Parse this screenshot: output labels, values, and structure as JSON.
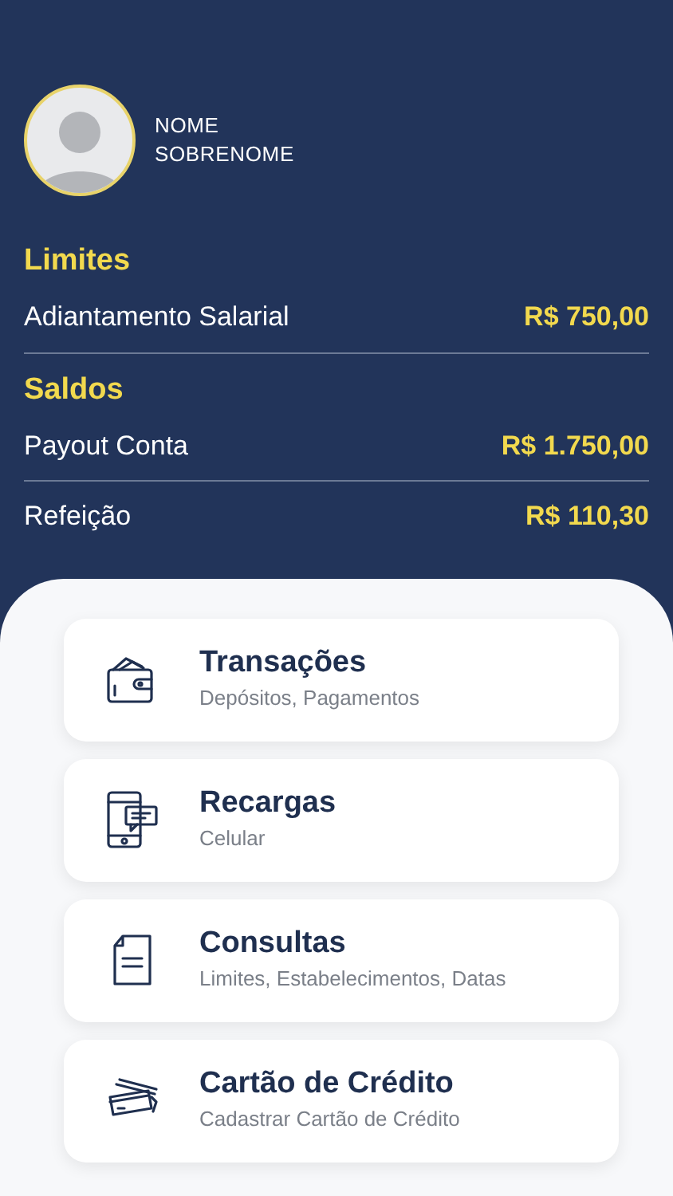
{
  "profile": {
    "first_name": "NOME",
    "last_name": "SOBRENOME"
  },
  "sections": [
    {
      "title": "Limites",
      "rows": [
        {
          "label": "Adiantamento Salarial",
          "value": "R$ 750,00"
        }
      ]
    },
    {
      "title": "Saldos",
      "rows": [
        {
          "label": "Payout Conta",
          "value": "R$ 1.750,00"
        },
        {
          "label": "Refeição",
          "value": "R$ 110,30"
        }
      ]
    }
  ],
  "menu": [
    {
      "kind": "wallet",
      "title": "Transações",
      "subtitle": "Depósitos, Pagamentos"
    },
    {
      "kind": "phone",
      "title": "Recargas",
      "subtitle": "Celular"
    },
    {
      "kind": "document",
      "title": "Consultas",
      "subtitle": "Limites, Estabelecimentos, Datas"
    },
    {
      "kind": "cards",
      "title": "Cartão de Crédito",
      "subtitle": "Cadastrar Cartão de Crédito"
    }
  ]
}
